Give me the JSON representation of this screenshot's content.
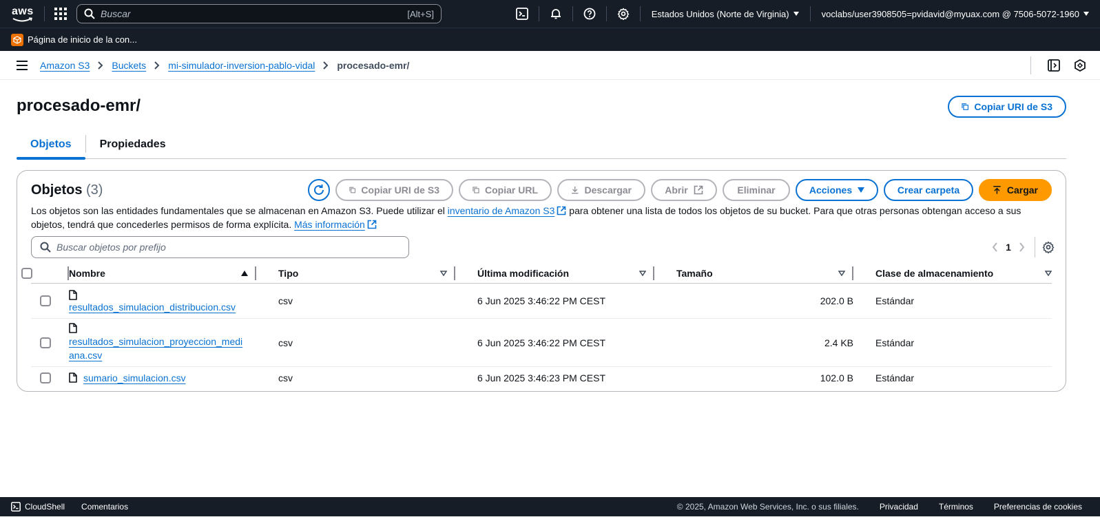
{
  "topnav": {
    "logo_text": "aws",
    "search_placeholder": "Buscar",
    "search_shortcut": "[Alt+S]",
    "icons": [
      "grid-icon",
      "cloudshell-icon",
      "bell-icon",
      "help-icon",
      "gear-icon"
    ],
    "region": "Estados Unidos (Norte de Virginia)",
    "account": "voclabs/user3908505=pvidavid@myuax.com @ 7506-5072-1960"
  },
  "favorites": {
    "item_label": "Página de inicio de la con..."
  },
  "breadcrumbs": [
    {
      "label": "Amazon S3"
    },
    {
      "label": "Buckets"
    },
    {
      "label": "mi-simulador-inversion-pablo-vidal"
    }
  ],
  "breadcrumb_current": "procesado-emr/",
  "page": {
    "title": "procesado-emr/",
    "copy_uri_label": "Copiar URI de S3"
  },
  "tabs": [
    {
      "label": "Objetos",
      "active": true
    },
    {
      "label": "Propiedades",
      "active": false
    }
  ],
  "objects_panel": {
    "title": "Objetos",
    "count": "(3)",
    "buttons": {
      "copy_uri": "Copiar URI de S3",
      "copy_url": "Copiar URL",
      "download": "Descargar",
      "open": "Abrir",
      "delete": "Eliminar",
      "actions": "Acciones",
      "create_folder": "Crear carpeta",
      "upload": "Cargar"
    },
    "description_1": "Los objetos son las entidades fundamentales que se almacenan en Amazon S3. Puede utilizar el ",
    "description_link_1": "inventario de Amazon S3",
    "description_2": " para obtener una lista de todos los objetos de su bucket. Para que otras personas obtengan acceso a sus objetos, tendrá que concederles permisos de forma explícita. ",
    "description_link_2": "Más información",
    "search_placeholder": "Buscar objetos por prefijo",
    "page_number": "1"
  },
  "table": {
    "columns": [
      "Nombre",
      "Tipo",
      "Última modificación",
      "Tamaño",
      "Clase de almacenamiento"
    ],
    "rows": [
      {
        "name": "resultados_simulacion_distribucion.csv",
        "type": "csv",
        "modified": "6 Jun 2025 3:46:22 PM CEST",
        "size": "202.0 B",
        "class": "Estándar"
      },
      {
        "name": "resultados_simulacion_proyeccion_mediana.csv",
        "type": "csv",
        "modified": "6 Jun 2025 3:46:22 PM CEST",
        "size": "2.4 KB",
        "class": "Estándar"
      },
      {
        "name": "sumario_simulacion.csv",
        "type": "csv",
        "modified": "6 Jun 2025 3:46:23 PM CEST",
        "size": "102.0 B",
        "class": "Estándar"
      }
    ]
  },
  "footer": {
    "cloudshell": "CloudShell",
    "feedback": "Comentarios",
    "copyright": "© 2025, Amazon Web Services, Inc. o sus filiales.",
    "privacy": "Privacidad",
    "terms": "Términos",
    "cookies": "Preferencias de cookies"
  },
  "colors": {
    "nav_bg": "#161d26",
    "link_blue": "#0972d3",
    "primary_orange": "#ff9900"
  }
}
